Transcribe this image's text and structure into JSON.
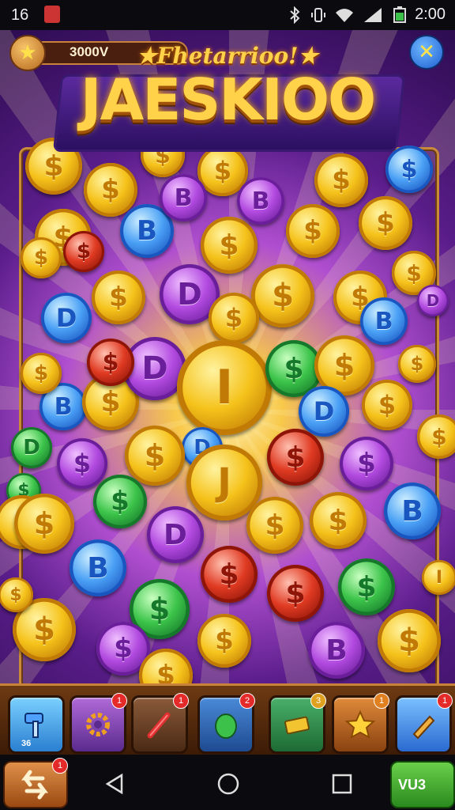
{
  "status_bar": {
    "time_left": "16",
    "time_right": "2:00"
  },
  "hud": {
    "coin_value": "3000V",
    "subtitle": "Fhetarrioo!",
    "title": "JAESKIOO",
    "close_symbol": "✕"
  },
  "colors": {
    "gold": "#f2b418",
    "purple": "#a03fd8",
    "blue": "#3b8ff0",
    "green": "#2fb24a",
    "red": "#d72a1e",
    "frame": "#c98a3a"
  },
  "toolbar": {
    "items": [
      {
        "name": "hammer-tool",
        "icon": "hammer-icon",
        "badge": "",
        "count": "36"
      },
      {
        "name": "gear-tool",
        "icon": "gear-icon",
        "badge": "1",
        "count": ""
      },
      {
        "name": "rocket-tool",
        "icon": "rocket-icon",
        "badge": "1",
        "count": ""
      },
      {
        "name": "leaf-tool",
        "icon": "leaf-icon",
        "badge": "2",
        "count": ""
      },
      {
        "name": "cash-tool",
        "icon": "cash-icon",
        "badge": "3",
        "count": ""
      },
      {
        "name": "star-tool",
        "icon": "star-icon",
        "badge": "1",
        "count": ""
      },
      {
        "name": "pencil-tool",
        "icon": "pencil-icon",
        "badge": "1",
        "count": ""
      }
    ]
  },
  "nav": {
    "right_label": "VU3",
    "left_badge": "1"
  },
  "coins": [
    {
      "c": "gold",
      "s": "$"
    },
    {
      "c": "gold",
      "s": "$"
    },
    {
      "c": "gold",
      "s": "$"
    },
    {
      "c": "gold",
      "s": "$"
    },
    {
      "c": "gold",
      "s": "$"
    },
    {
      "c": "blue",
      "s": "$"
    },
    {
      "c": "gold",
      "s": "$"
    },
    {
      "c": "red",
      "s": "$"
    },
    {
      "c": "blue",
      "s": "B"
    },
    {
      "c": "purple",
      "s": "B"
    },
    {
      "c": "gold",
      "s": "$"
    },
    {
      "c": "purple",
      "s": "B"
    },
    {
      "c": "gold",
      "s": "$"
    },
    {
      "c": "gold",
      "s": "$"
    },
    {
      "c": "gold",
      "s": "$"
    },
    {
      "c": "gold",
      "s": "$"
    },
    {
      "c": "purple",
      "s": "D"
    },
    {
      "c": "gold",
      "s": "$"
    },
    {
      "c": "blue",
      "s": "D"
    },
    {
      "c": "gold",
      "s": "$"
    },
    {
      "c": "gold",
      "s": "$"
    },
    {
      "c": "blue",
      "s": "B"
    },
    {
      "c": "gold",
      "s": "$"
    },
    {
      "c": "purple",
      "s": "D"
    },
    {
      "c": "green",
      "s": "$"
    },
    {
      "c": "blue",
      "s": "B"
    },
    {
      "c": "gold",
      "s": "$"
    },
    {
      "c": "purple",
      "s": "D"
    },
    {
      "c": "gold",
      "s": "I"
    },
    {
      "c": "green",
      "s": "$"
    },
    {
      "c": "gold",
      "s": "$"
    },
    {
      "c": "gold",
      "s": "$"
    },
    {
      "c": "blue",
      "s": "D"
    },
    {
      "c": "red",
      "s": "$"
    },
    {
      "c": "blue",
      "s": "D"
    },
    {
      "c": "gold",
      "s": "$"
    },
    {
      "c": "gold",
      "s": "$"
    },
    {
      "c": "green",
      "s": "D"
    },
    {
      "c": "purple",
      "s": "$"
    },
    {
      "c": "gold",
      "s": "$"
    },
    {
      "c": "gold",
      "s": "J"
    },
    {
      "c": "red",
      "s": "$"
    },
    {
      "c": "purple",
      "s": "$"
    },
    {
      "c": "gold",
      "s": "$"
    },
    {
      "c": "gold",
      "s": "$"
    },
    {
      "c": "green",
      "s": "$"
    },
    {
      "c": "gold",
      "s": "$"
    },
    {
      "c": "blue",
      "s": "B"
    },
    {
      "c": "gold",
      "s": "$"
    },
    {
      "c": "blue",
      "s": "B"
    },
    {
      "c": "purple",
      "s": "D"
    },
    {
      "c": "gold",
      "s": "$"
    },
    {
      "c": "red",
      "s": "$"
    },
    {
      "c": "red",
      "s": "$"
    },
    {
      "c": "green",
      "s": "$"
    },
    {
      "c": "gold",
      "s": "$"
    },
    {
      "c": "green",
      "s": "$"
    },
    {
      "c": "gold",
      "s": "$"
    },
    {
      "c": "gold",
      "s": "$"
    },
    {
      "c": "purple",
      "s": "$"
    },
    {
      "c": "purple",
      "s": "B"
    },
    {
      "c": "gold",
      "s": "$"
    },
    {
      "c": "gold",
      "s": "$"
    },
    {
      "c": "gold",
      "s": "I"
    }
  ]
}
